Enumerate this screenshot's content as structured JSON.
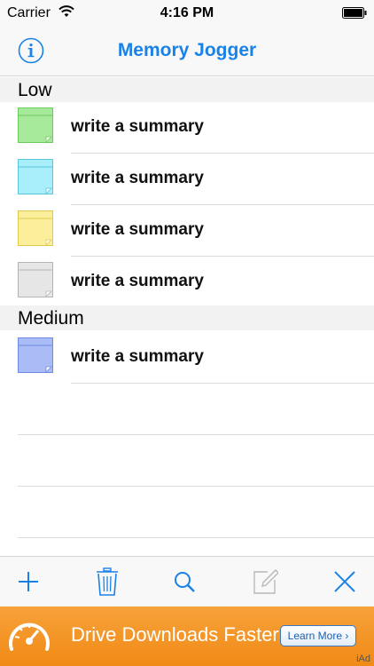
{
  "status_bar": {
    "carrier": "Carrier",
    "time": "4:16 PM"
  },
  "navbar": {
    "title": "Memory Jogger",
    "info_icon": "info-icon"
  },
  "sections": [
    {
      "title": "Low",
      "items": [
        {
          "label": "write a summary",
          "color": "#a6e99a"
        },
        {
          "label": "write a summary",
          "color": "#a8effb"
        },
        {
          "label": "write a summary",
          "color": "#fbef9c"
        },
        {
          "label": "write a summary",
          "color": "#e6e6e6"
        }
      ]
    },
    {
      "title": "Medium",
      "items": [
        {
          "label": "write a summary",
          "color": "#a9bcf5"
        }
      ]
    }
  ],
  "toolbar": {
    "items": [
      "add-icon",
      "trash-icon",
      "search-icon",
      "compose-icon",
      "close-icon"
    ],
    "accent": "#1a82e6",
    "disabled": "#b8b8b8"
  },
  "ad": {
    "text": "Drive Downloads Faster",
    "button": "Learn More",
    "badge": "iAd"
  }
}
